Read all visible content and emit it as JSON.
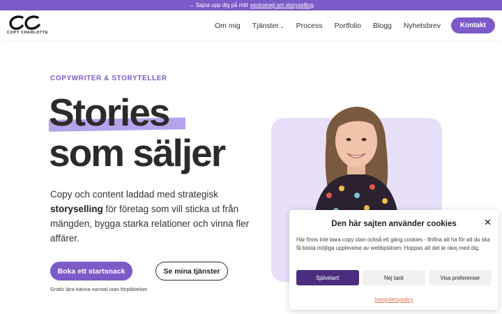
{
  "announcement": {
    "prefix": "→ Sajna upp dig på mitt",
    "link": "veckomejl om storyselling"
  },
  "logo": {
    "text": "COPY CHARLOTTE"
  },
  "nav": {
    "items": [
      "Om mig",
      "Tjänster",
      "Process",
      "Portfolio",
      "Blogg",
      "Nyhetsbrev"
    ],
    "cta": "Kontakt"
  },
  "hero": {
    "eyebrow": "COPYWRITER & STORYTELLER",
    "headline_line1": "Stories",
    "headline_line2": "som säljer",
    "body_pre": "Copy och content laddad med strategisk",
    "body_bold": "storyselling",
    "body_post": "för företag som vill sticka ut från mängden, bygga starka relationer och vinna fler affärer.",
    "primary_cta": "Boka ett startsnack",
    "secondary_cta": "Se mina tjänster",
    "note": "Gratis lära-känna-samtal utan förpliktelser"
  },
  "cookie": {
    "title": "Den här sajten använder cookies",
    "text": "Här finns inte bara copy utan också ett gäng cookies - finfina att ha för att du ska få bästa möjliga upplevelse av webbplatsen. Hoppas att det är okej med dig.",
    "accept": "Självklart!",
    "deny": "Nej tack",
    "preferences": "Visa preferenser",
    "policy": "Integritetspolicy"
  },
  "colors": {
    "brand": "#7c5ac8",
    "highlight": "#b5a3ec",
    "photo_bg": "#e7e0f8",
    "cookie_accept": "#4a2e7d",
    "policy_link": "#e06d50"
  }
}
